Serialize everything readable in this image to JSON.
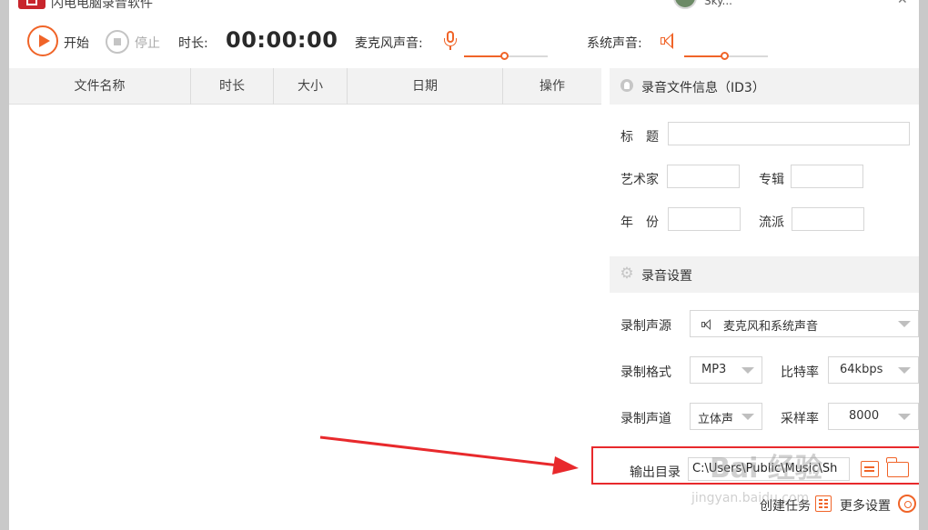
{
  "app": {
    "title": "闪电电脑录音软件",
    "user_name": "Sky..."
  },
  "toolbar": {
    "start_label": "开始",
    "stop_label": "停止",
    "duration_label": "时长:",
    "duration_value": "00:00:00",
    "mic_label": "麦克风声音:",
    "system_label": "系统声音:",
    "mic_volume": 0.48,
    "system_volume": 0.48
  },
  "file_table": {
    "columns": [
      "文件名称",
      "时长",
      "大小",
      "日期",
      "操作"
    ],
    "rows": []
  },
  "id3": {
    "header": "录音文件信息（ID3）",
    "title_label": "标　题",
    "artist_label": "艺术家",
    "album_label": "专辑",
    "year_label": "年　份",
    "genre_label": "流派"
  },
  "record_settings": {
    "header": "录音设置",
    "source_label": "录制声源",
    "source_value": "麦克风和系统声音",
    "format_label": "录制格式",
    "format_value": "MP3",
    "bitrate_label": "比特率",
    "bitrate_value": "64kbps",
    "channel_label": "录制声道",
    "channel_value": "立体声",
    "samplerate_label": "采样率",
    "samplerate_value": "8000",
    "output_label": "输出目录",
    "output_value": "C:\\Users\\Public\\Music\\Sh"
  },
  "footer": {
    "create_task": "创建任务",
    "more_settings": "更多设置"
  },
  "colors": {
    "accent": "#f06428",
    "highlight": "#e8292c",
    "header_bg": "#f2f2f2"
  },
  "watermark": {
    "text": "Bai 经验",
    "url": "jingyan.baidu.com"
  }
}
